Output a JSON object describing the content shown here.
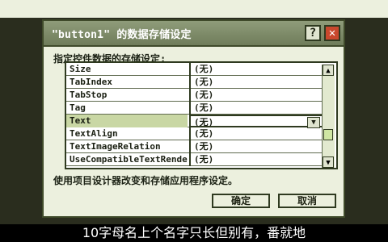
{
  "dialog": {
    "title": "\"button1\" 的数据存储设定",
    "help_label": "?",
    "close_label": "✕",
    "instruction": "指定控件数据的存储设定:",
    "hint": "使用项目设计器改变和存储应用程序设定。",
    "ok_label": "确定",
    "cancel_label": "取消"
  },
  "properties": [
    {
      "name": "Size",
      "value": "(无)"
    },
    {
      "name": "TabIndex",
      "value": "(无)"
    },
    {
      "name": "TabStop",
      "value": "(无)"
    },
    {
      "name": "Tag",
      "value": "(无)"
    },
    {
      "name": "Text",
      "value": "(无)",
      "selected": true
    },
    {
      "name": "TextAlign",
      "value": "(无)"
    },
    {
      "name": "TextImageRelation",
      "value": "(无)"
    },
    {
      "name": "UseCompatibleTextRendering",
      "value": "(无)"
    }
  ],
  "scrollbar": {
    "up_icon": "▲",
    "down_icon": "▼"
  },
  "dropdown_icon": "▼",
  "subtitle": "10字母名上个名字只长但别有，番就地"
}
